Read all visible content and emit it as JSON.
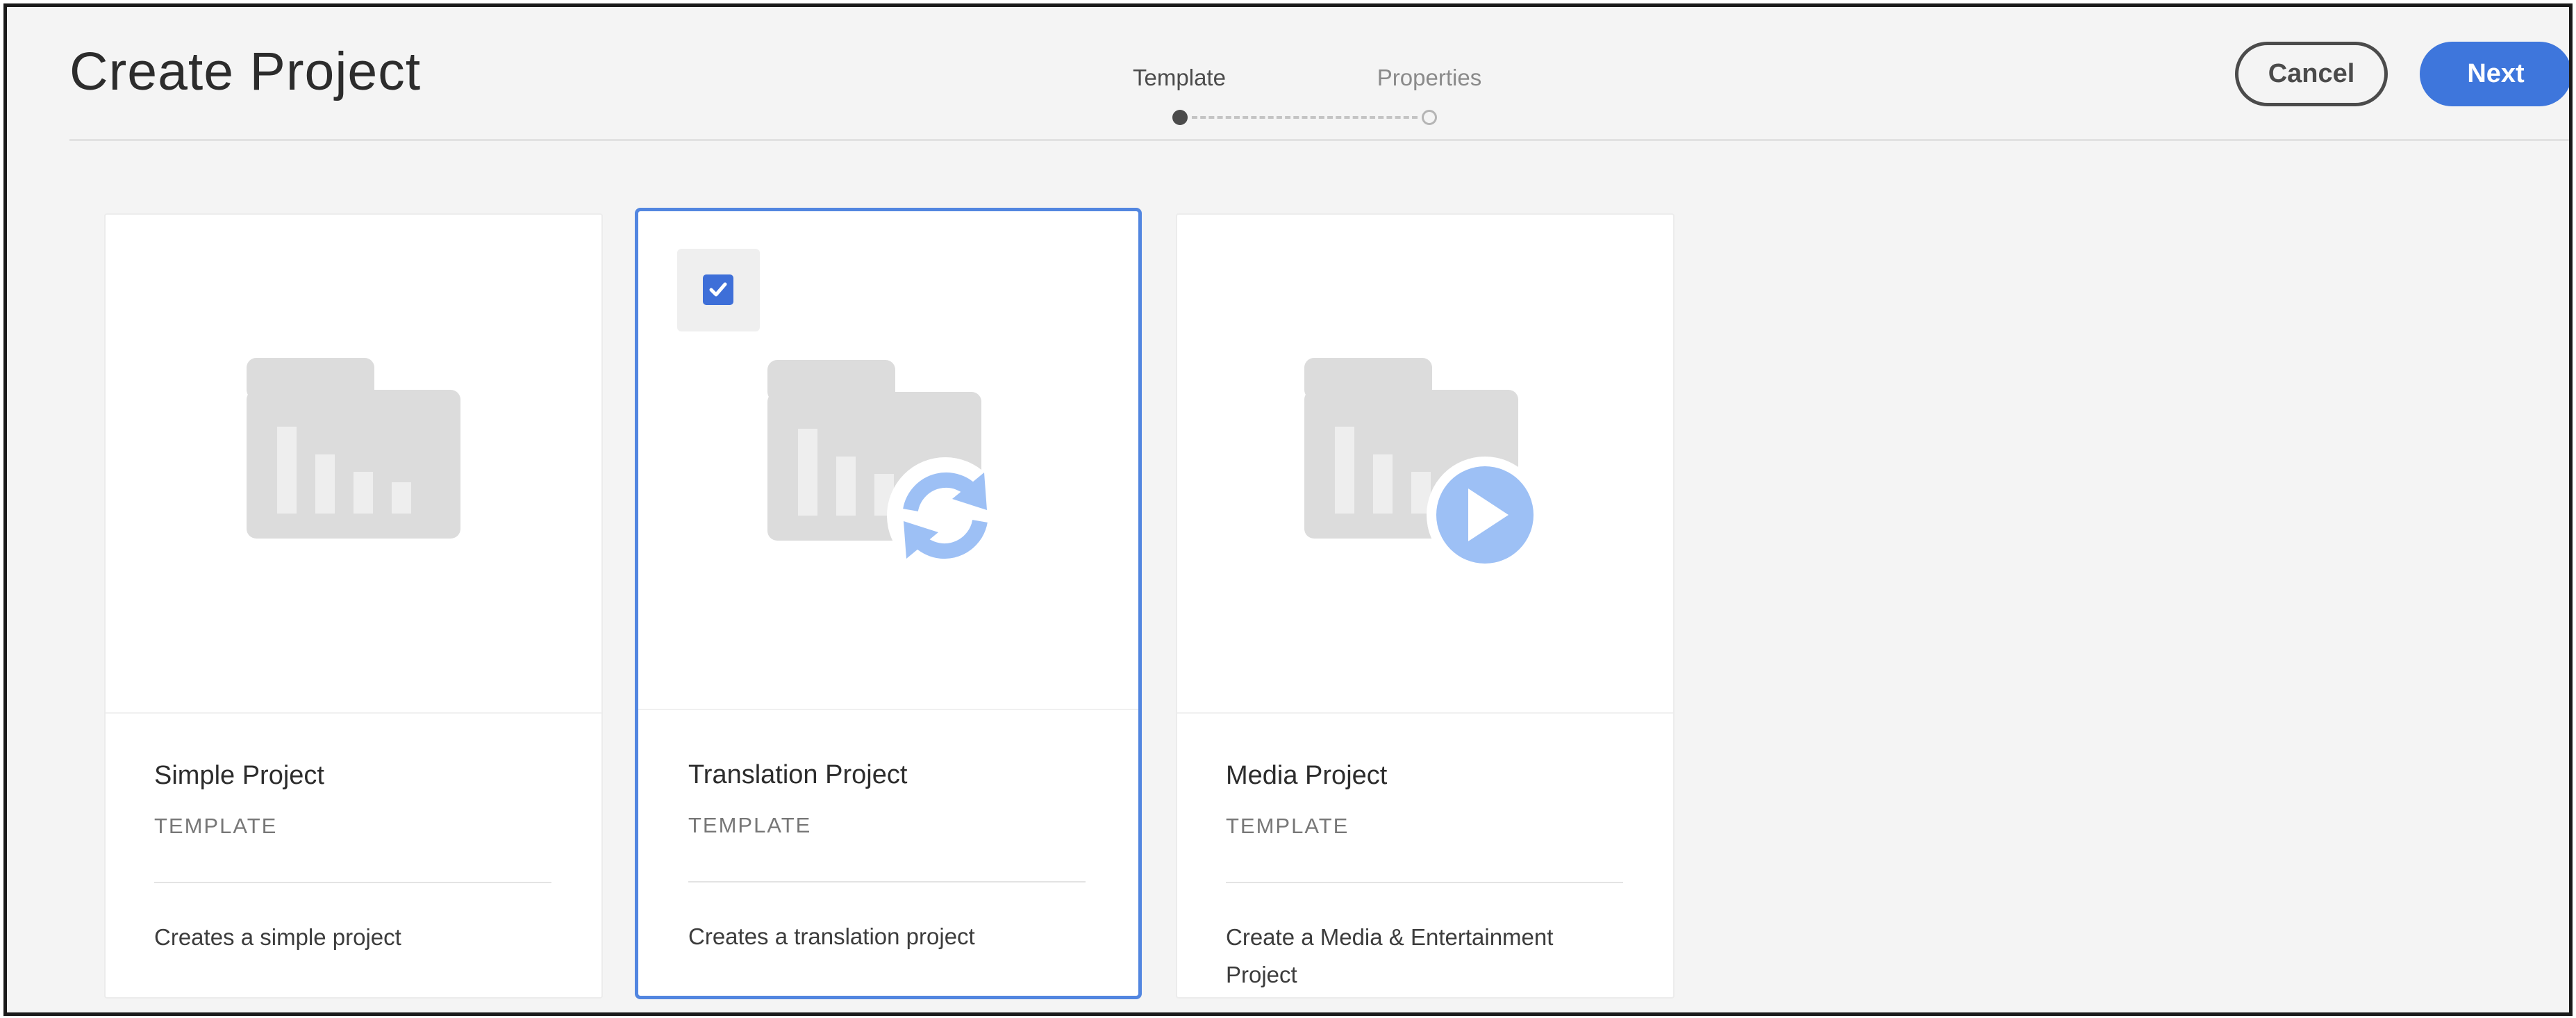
{
  "header": {
    "title": "Create Project",
    "cancel_label": "Cancel",
    "next_label": "Next"
  },
  "wizard": {
    "steps": [
      {
        "label": "Template",
        "active": true
      },
      {
        "label": "Properties",
        "active": false
      }
    ]
  },
  "cards": [
    {
      "title": "Simple Project",
      "subtitle": "TEMPLATE",
      "description": "Creates a simple project",
      "selected": false,
      "icon": "folder-chart-icon"
    },
    {
      "title": "Translation Project",
      "subtitle": "TEMPLATE",
      "description": "Creates a translation project",
      "selected": true,
      "icon": "folder-chart-sync-icon"
    },
    {
      "title": "Media Project",
      "subtitle": "TEMPLATE",
      "description": "Create a Media & Entertainment Project",
      "selected": false,
      "icon": "folder-chart-play-icon"
    }
  ],
  "colors": {
    "accent": "#3e76dc",
    "selected_border": "#5286e0",
    "overlay_icon": "#9dc0f5",
    "folder_icon": "#dcdcdc",
    "background": "#f4f4f4"
  }
}
